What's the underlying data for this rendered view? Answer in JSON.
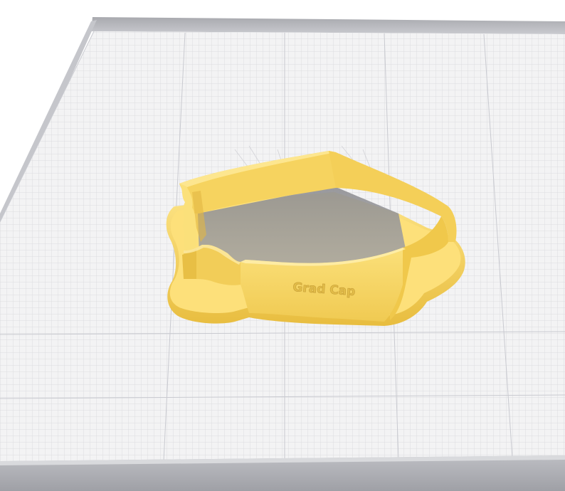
{
  "viewer": {
    "model": {
      "engraved_text": "Grad Cap",
      "color": "#f9d96a"
    },
    "build_plate": {
      "grid": true,
      "color": "#f2f2f3",
      "grid_color": "#d3d4da",
      "rim_color": "#b9babf"
    }
  }
}
